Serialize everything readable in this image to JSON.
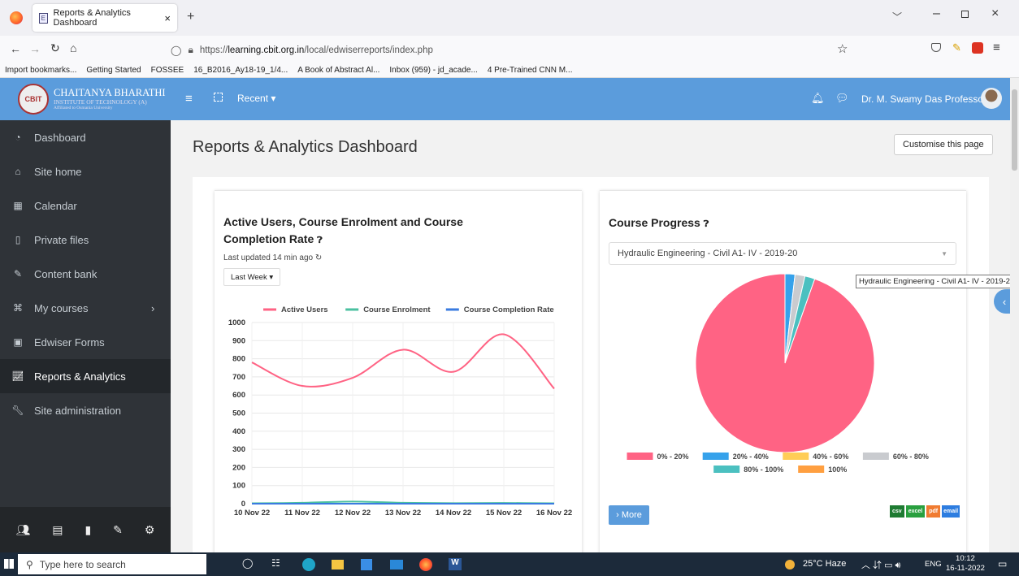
{
  "browser": {
    "tab_title": "Reports & Analytics Dashboard",
    "tab_close": "×",
    "new_tab": "+",
    "url": "https://learning.cbit.org.in/local/edwiserreports/index.php",
    "url_host": "learning.cbit.org.in",
    "url_prefix": "https://",
    "url_suffix": "/local/edwiserreports/index.php",
    "bookmarks": [
      "Import bookmarks...",
      "Getting Started",
      "FOSSEE",
      "16_B2016_Ay18-19_1/4...",
      "A Book of Abstract Al...",
      "Inbox (959) - jd_acade...",
      "4 Pre-Trained CNN M..."
    ]
  },
  "header": {
    "brand_line1": "CHAITANYA BHARATHI",
    "brand_line2": "INSTITUTE OF TECHNOLOGY (A)",
    "brand_line3": "Affiliated to Osmania University",
    "recent": "Recent ▾",
    "user_name": "Dr. M. Swamy Das Professor"
  },
  "sidebar": {
    "items": [
      {
        "label": "Dashboard",
        "icon": "dashboard-icon"
      },
      {
        "label": "Site home",
        "icon": "home-icon"
      },
      {
        "label": "Calendar",
        "icon": "calendar-icon"
      },
      {
        "label": "Private files",
        "icon": "file-icon"
      },
      {
        "label": "Content bank",
        "icon": "brush-icon"
      },
      {
        "label": "My courses",
        "icon": "graduation-icon"
      },
      {
        "label": "Edwiser Forms",
        "icon": "form-icon"
      },
      {
        "label": "Reports & Analytics",
        "icon": "chart-icon"
      },
      {
        "label": "Site administration",
        "icon": "wrench-icon"
      }
    ],
    "active": "Reports & Analytics"
  },
  "page": {
    "title": "Reports & Analytics Dashboard",
    "customise_button": "Customise this page"
  },
  "card1": {
    "title_line1": "Active Users, Course Enrolment and Course",
    "title_line2": "Completion Rate",
    "last_updated": "Last updated 14 min ago",
    "period": "Last Week ▾"
  },
  "card2": {
    "title": "Course Progress",
    "course_select": "Hydraulic Engineering - Civil A1- IV - 2019-20",
    "tooltip": "Hydraulic Engineering - Civil A1- IV - 2019-20",
    "more_button": "› More",
    "exports": [
      "csv",
      "excel",
      "pdf",
      "email"
    ]
  },
  "chart_data": [
    {
      "type": "line",
      "title": "Active Users, Course Enrolment and Course Completion Rate",
      "x": [
        "10 Nov 22",
        "11 Nov 22",
        "12 Nov 22",
        "13 Nov 22",
        "14 Nov 22",
        "15 Nov 22",
        "16 Nov 22"
      ],
      "ylim": [
        0,
        1000
      ],
      "yticks": [
        0,
        100,
        200,
        300,
        400,
        500,
        600,
        700,
        800,
        900,
        1000
      ],
      "grid": true,
      "legend": "top",
      "series": [
        {
          "name": "Active Users",
          "color": "#ff6384",
          "values": [
            780,
            650,
            695,
            850,
            728,
            935,
            635
          ]
        },
        {
          "name": "Course Enrolment",
          "color": "#4bc0a0",
          "values": [
            2,
            5,
            12,
            5,
            3,
            4,
            2
          ]
        },
        {
          "name": "Course Completion Rate",
          "color": "#3a7be0",
          "values": [
            0,
            0,
            0,
            0,
            0,
            0,
            0
          ]
        }
      ]
    },
    {
      "type": "pie",
      "title": "Course Progress",
      "legend": "bottom",
      "categories": [
        "0% - 20%",
        "20% - 40%",
        "40% - 60%",
        "60% - 80%",
        "80% - 100%",
        "100%"
      ],
      "values": [
        94.6,
        1.8,
        0,
        1.8,
        1.8,
        0
      ],
      "colors": [
        "#ff6384",
        "#36a2eb",
        "#ffcd56",
        "#c9cbcf",
        "#4bc0c0",
        "#ff9f40"
      ]
    }
  ],
  "taskbar": {
    "search_placeholder": "Type here to search",
    "weather": "25°C Haze",
    "lang": "ENG",
    "time": "10:12",
    "date": "16-11-2022"
  }
}
